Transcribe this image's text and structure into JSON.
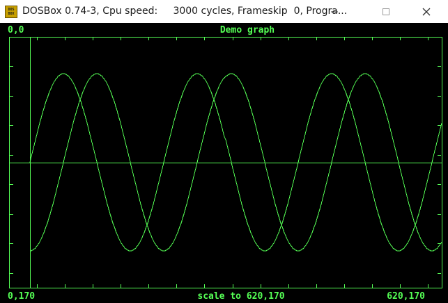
{
  "window": {
    "title": "DOSBox 0.74-3, Cpu speed:     3000 cycles, Frameskip  0, Progra...",
    "icon": "dosbox-icon",
    "icon_text": [
      "DOS",
      "BOX"
    ],
    "controls": [
      "minimize-icon",
      "maximize-icon",
      "close-icon"
    ]
  },
  "screen": {
    "top_left_label": "0,0",
    "title": "Demo graph",
    "bottom_left_label": "0,170",
    "bottom_center_label": "scale to 620,170",
    "bottom_right_label": "620,170",
    "foreground_color": "#55ff55",
    "background_color": "#000000"
  },
  "chart_data": {
    "type": "line",
    "title": "Demo graph",
    "x_range": [
      0,
      620
    ],
    "y_range": [
      0,
      170
    ],
    "y_axis_at_x": 30,
    "baseline_y": 85,
    "series": [
      {
        "function": "sine",
        "amplitude": 60,
        "period": 192,
        "phase_start_x": 30,
        "x_start": 30,
        "x_end": 620
      },
      {
        "function": "negative-cosine",
        "amplitude": 60,
        "period": 192,
        "phase_start_x": 30,
        "x_start": 30,
        "x_end": 620
      }
    ]
  }
}
